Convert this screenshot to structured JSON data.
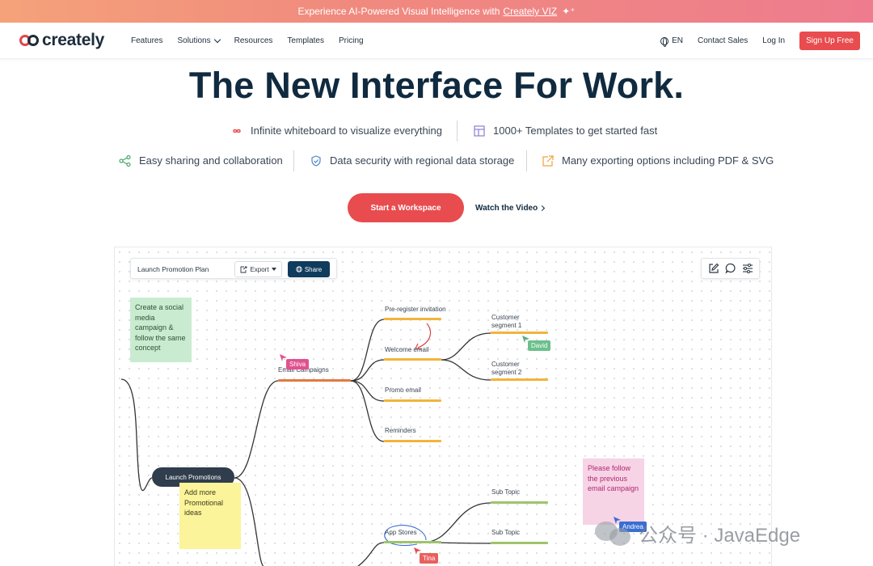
{
  "banner": {
    "prefix": "Experience AI-Powered Visual Intelligence with",
    "link": "Creately VIZ",
    "spark": "✦⁺"
  },
  "brand": {
    "name": "creately"
  },
  "nav": {
    "links": [
      "Features",
      "Solutions",
      "Resources",
      "Templates",
      "Pricing"
    ],
    "lang": "EN",
    "contact": "Contact Sales",
    "login": "Log In",
    "signup": "Sign Up Free"
  },
  "hero": {
    "title": "The New Interface For Work.",
    "features": [
      "Infinite whiteboard to visualize everything",
      "1000+ Templates to get started fast",
      "Easy sharing and collaboration",
      "Data security with regional data storage",
      "Many exporting options including PDF & SVG"
    ],
    "cta": "Start a Workspace",
    "watch": "Watch the Video"
  },
  "board": {
    "doc_title": "Launch Promotion Plan",
    "export_label": "Export",
    "share_label": "Share",
    "root": "Launch Promotions",
    "branch": "Email Campaigns",
    "nodes": [
      "Pre-register invitation",
      "Welcome email",
      "Promo email",
      "Reminders"
    ],
    "segments": [
      "Customer segment 1",
      "Customer segment 2"
    ],
    "app_stores": "App Stores",
    "sub_topics": [
      "Sub Topic",
      "Sub Topic"
    ],
    "sticky_green": "Create a social media campaign & follow the same concept",
    "sticky_yellow": "Add more Promotional ideas",
    "sticky_pink": "Please follow the previous email campaign",
    "cursors": {
      "shiva": "Shiva",
      "david": "David",
      "andrea": "Andrea",
      "tina": "Tina"
    },
    "colors": {
      "orange": "#f2b43c",
      "green": "#9fc36b",
      "brand": "#e84c4f",
      "navy": "#0f3b5c"
    }
  },
  "watermark": {
    "text": "公众号 · JavaEdge"
  }
}
